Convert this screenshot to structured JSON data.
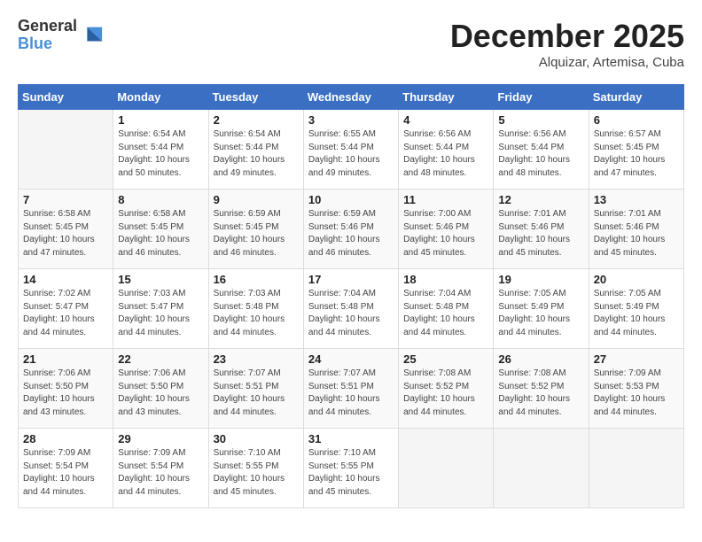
{
  "logo": {
    "general": "General",
    "blue": "Blue"
  },
  "header": {
    "month": "December 2025",
    "location": "Alquizar, Artemisa, Cuba"
  },
  "days_of_week": [
    "Sunday",
    "Monday",
    "Tuesday",
    "Wednesday",
    "Thursday",
    "Friday",
    "Saturday"
  ],
  "weeks": [
    [
      {
        "day": "",
        "info": ""
      },
      {
        "day": "1",
        "info": "Sunrise: 6:54 AM\nSunset: 5:44 PM\nDaylight: 10 hours\nand 50 minutes."
      },
      {
        "day": "2",
        "info": "Sunrise: 6:54 AM\nSunset: 5:44 PM\nDaylight: 10 hours\nand 49 minutes."
      },
      {
        "day": "3",
        "info": "Sunrise: 6:55 AM\nSunset: 5:44 PM\nDaylight: 10 hours\nand 49 minutes."
      },
      {
        "day": "4",
        "info": "Sunrise: 6:56 AM\nSunset: 5:44 PM\nDaylight: 10 hours\nand 48 minutes."
      },
      {
        "day": "5",
        "info": "Sunrise: 6:56 AM\nSunset: 5:44 PM\nDaylight: 10 hours\nand 48 minutes."
      },
      {
        "day": "6",
        "info": "Sunrise: 6:57 AM\nSunset: 5:45 PM\nDaylight: 10 hours\nand 47 minutes."
      }
    ],
    [
      {
        "day": "7",
        "info": "Sunrise: 6:58 AM\nSunset: 5:45 PM\nDaylight: 10 hours\nand 47 minutes."
      },
      {
        "day": "8",
        "info": "Sunrise: 6:58 AM\nSunset: 5:45 PM\nDaylight: 10 hours\nand 46 minutes."
      },
      {
        "day": "9",
        "info": "Sunrise: 6:59 AM\nSunset: 5:45 PM\nDaylight: 10 hours\nand 46 minutes."
      },
      {
        "day": "10",
        "info": "Sunrise: 6:59 AM\nSunset: 5:46 PM\nDaylight: 10 hours\nand 46 minutes."
      },
      {
        "day": "11",
        "info": "Sunrise: 7:00 AM\nSunset: 5:46 PM\nDaylight: 10 hours\nand 45 minutes."
      },
      {
        "day": "12",
        "info": "Sunrise: 7:01 AM\nSunset: 5:46 PM\nDaylight: 10 hours\nand 45 minutes."
      },
      {
        "day": "13",
        "info": "Sunrise: 7:01 AM\nSunset: 5:46 PM\nDaylight: 10 hours\nand 45 minutes."
      }
    ],
    [
      {
        "day": "14",
        "info": "Sunrise: 7:02 AM\nSunset: 5:47 PM\nDaylight: 10 hours\nand 44 minutes."
      },
      {
        "day": "15",
        "info": "Sunrise: 7:03 AM\nSunset: 5:47 PM\nDaylight: 10 hours\nand 44 minutes."
      },
      {
        "day": "16",
        "info": "Sunrise: 7:03 AM\nSunset: 5:48 PM\nDaylight: 10 hours\nand 44 minutes."
      },
      {
        "day": "17",
        "info": "Sunrise: 7:04 AM\nSunset: 5:48 PM\nDaylight: 10 hours\nand 44 minutes."
      },
      {
        "day": "18",
        "info": "Sunrise: 7:04 AM\nSunset: 5:48 PM\nDaylight: 10 hours\nand 44 minutes."
      },
      {
        "day": "19",
        "info": "Sunrise: 7:05 AM\nSunset: 5:49 PM\nDaylight: 10 hours\nand 44 minutes."
      },
      {
        "day": "20",
        "info": "Sunrise: 7:05 AM\nSunset: 5:49 PM\nDaylight: 10 hours\nand 44 minutes."
      }
    ],
    [
      {
        "day": "21",
        "info": "Sunrise: 7:06 AM\nSunset: 5:50 PM\nDaylight: 10 hours\nand 43 minutes."
      },
      {
        "day": "22",
        "info": "Sunrise: 7:06 AM\nSunset: 5:50 PM\nDaylight: 10 hours\nand 43 minutes."
      },
      {
        "day": "23",
        "info": "Sunrise: 7:07 AM\nSunset: 5:51 PM\nDaylight: 10 hours\nand 44 minutes."
      },
      {
        "day": "24",
        "info": "Sunrise: 7:07 AM\nSunset: 5:51 PM\nDaylight: 10 hours\nand 44 minutes."
      },
      {
        "day": "25",
        "info": "Sunrise: 7:08 AM\nSunset: 5:52 PM\nDaylight: 10 hours\nand 44 minutes."
      },
      {
        "day": "26",
        "info": "Sunrise: 7:08 AM\nSunset: 5:52 PM\nDaylight: 10 hours\nand 44 minutes."
      },
      {
        "day": "27",
        "info": "Sunrise: 7:09 AM\nSunset: 5:53 PM\nDaylight: 10 hours\nand 44 minutes."
      }
    ],
    [
      {
        "day": "28",
        "info": "Sunrise: 7:09 AM\nSunset: 5:54 PM\nDaylight: 10 hours\nand 44 minutes."
      },
      {
        "day": "29",
        "info": "Sunrise: 7:09 AM\nSunset: 5:54 PM\nDaylight: 10 hours\nand 44 minutes."
      },
      {
        "day": "30",
        "info": "Sunrise: 7:10 AM\nSunset: 5:55 PM\nDaylight: 10 hours\nand 45 minutes."
      },
      {
        "day": "31",
        "info": "Sunrise: 7:10 AM\nSunset: 5:55 PM\nDaylight: 10 hours\nand 45 minutes."
      },
      {
        "day": "",
        "info": ""
      },
      {
        "day": "",
        "info": ""
      },
      {
        "day": "",
        "info": ""
      }
    ]
  ]
}
